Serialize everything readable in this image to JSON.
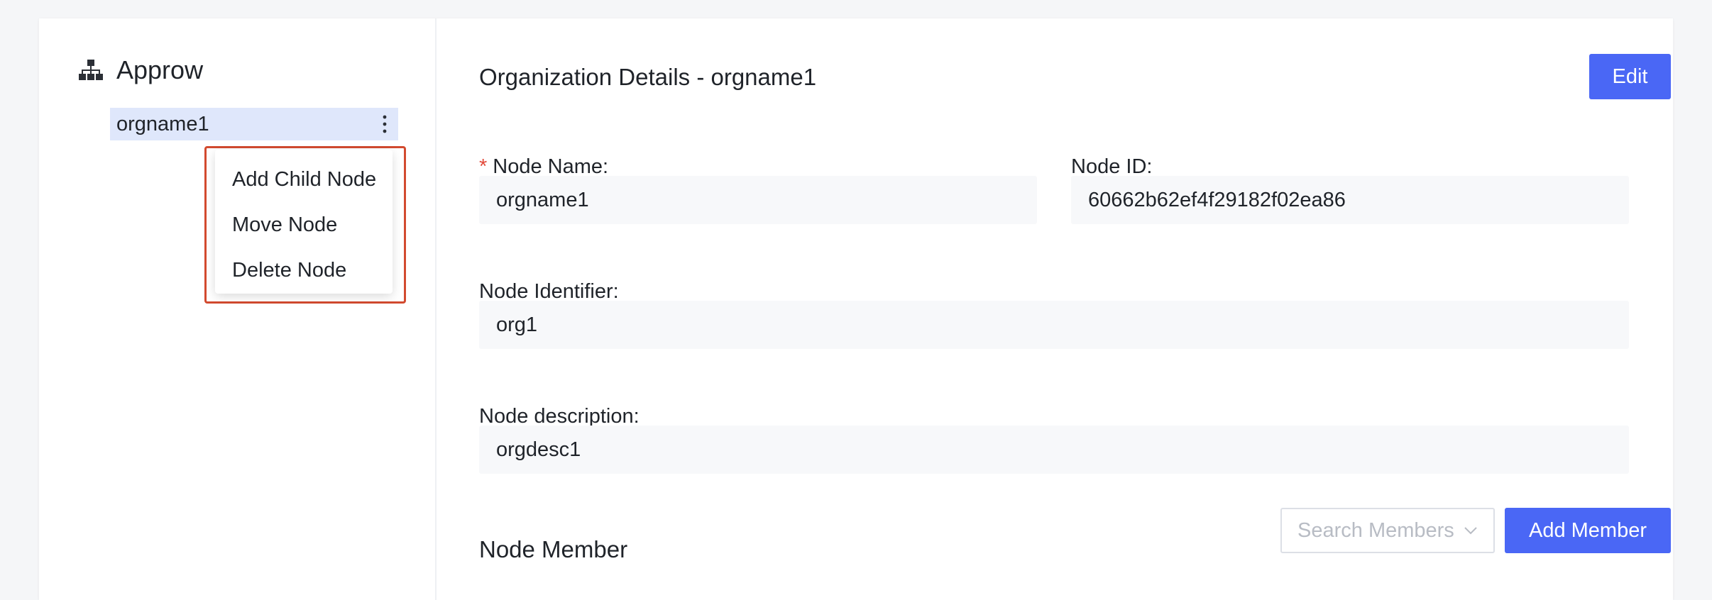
{
  "tree": {
    "root_label": "Approw",
    "root_icon": "org-tree-icon",
    "node_label": "orgname1",
    "node_more_icon": "vertical-ellipsis-icon",
    "context_menu": {
      "items": [
        {
          "label": "Add Child Node"
        },
        {
          "label": "Move Node"
        },
        {
          "label": "Delete Node"
        }
      ]
    }
  },
  "details": {
    "title": "Organization Details - orgname1",
    "edit_label": "Edit",
    "fields": {
      "node_name": {
        "label": "Node Name:",
        "required_mark": "*",
        "value": "orgname1"
      },
      "node_id": {
        "label": "Node ID:",
        "value": "60662b62ef4f29182f02ea86"
      },
      "node_identifier": {
        "label": "Node Identifier:",
        "value": "org1"
      },
      "node_description": {
        "label": "Node description:",
        "value": "orgdesc1"
      }
    },
    "members": {
      "section_title": "Node Member",
      "search_placeholder": "Search Members",
      "add_member_label": "Add Member"
    }
  },
  "colors": {
    "primary": "#4a67f5",
    "selected_node_bg": "#dfe7fb",
    "highlight_border": "#d24a2f",
    "required": "#e24a3b",
    "field_bg": "#f7f8fa"
  }
}
